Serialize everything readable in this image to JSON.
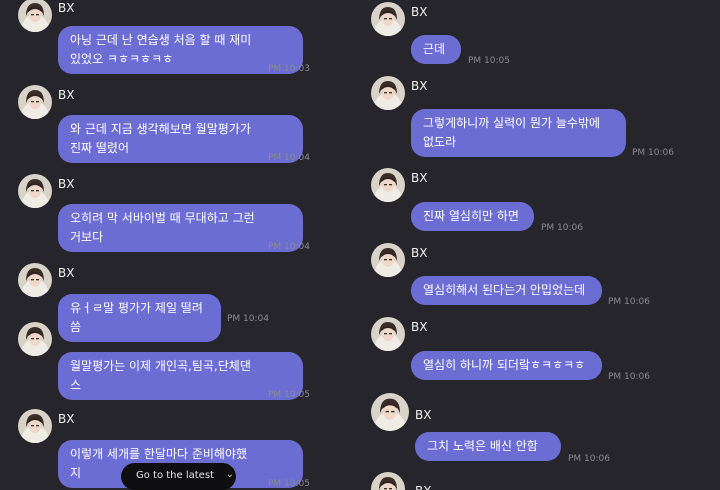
{
  "sender_name": "BX",
  "left_messages": [
    {
      "text": "아닝 근데 난 연습생 처음 할 때 재미\n있었오 ㅋㅎㅋㅎㅋㅎ",
      "time": "PM 10:03"
    },
    {
      "text": "와 근데 지금 생각해보면 월말평가가\n진짜 떨렸어",
      "time": "PM 10:04"
    },
    {
      "text": "오히려 막 서바이벌 때 무대하고 그런\n거보다",
      "time": "PM 10:04"
    },
    {
      "text": "유ㅓㄹ말 평가가 제일 떨려씀",
      "time": "PM 10:04"
    },
    {
      "text": "월말평가는 이제 개인곡,팀곡,단체댄\n스",
      "time": "PM 10:05"
    },
    {
      "text": "이렇개 세개를 한달마다 준비해야했\n지",
      "time": "PM 10:05"
    }
  ],
  "right_messages": [
    {
      "text": "근데",
      "time": "PM 10:05"
    },
    {
      "text": "그렇게하니까 실력이 뭔가 늘수밖에\n없도라",
      "time": "PM 10:06"
    },
    {
      "text": "진짜 열심히만 하면",
      "time": "PM 10:06"
    },
    {
      "text": "열심히해서 된다는거 안밉었는데",
      "time": "PM 10:06"
    },
    {
      "text": "열심히 하니까 되더랔ㅎㅋㅎㅋㅎ",
      "time": "PM 10:06"
    },
    {
      "text": "그치 노력은 배신 안함",
      "time": "PM 10:06"
    }
  ],
  "partial_bottom_name": "BX",
  "go_to_latest_label": "Go to the latest",
  "chevron_glyph": "⌄",
  "colors": {
    "background": "#26252b",
    "bubble": "#6c6dd2",
    "timestamp": "#8a8a94",
    "latest_button": "#0f0f12"
  },
  "icons": {
    "avatar": "profile-photo",
    "chevron": "chevron-down-icon"
  }
}
